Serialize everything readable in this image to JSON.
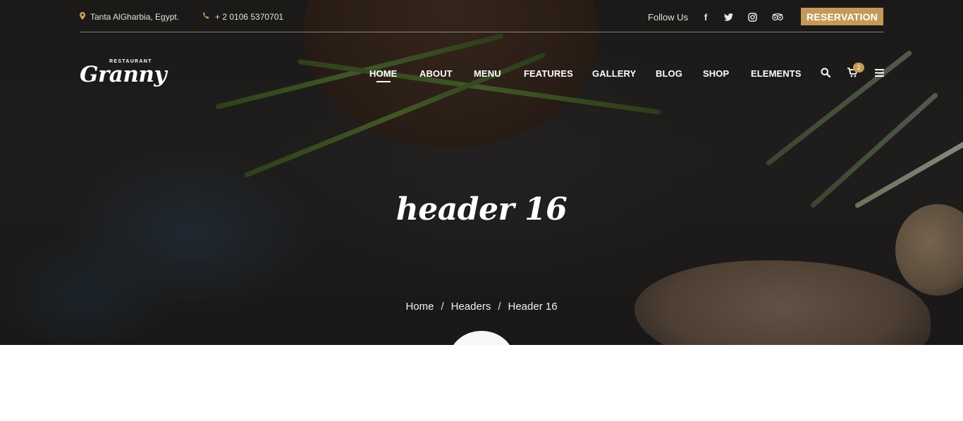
{
  "topbar": {
    "address": "Tanta AlGharbia, Egypt.",
    "phone": "+ 2 0106 5370701",
    "follow_label": "Follow Us",
    "social_icons": [
      "facebook-icon",
      "twitter-icon",
      "instagram-icon",
      "tripadvisor-icon"
    ],
    "reservation_label": "RESERVATION"
  },
  "logo": {
    "tag": "RESTAURANT",
    "name": "Granny"
  },
  "nav": {
    "items": [
      {
        "label": "HOME",
        "active": true
      },
      {
        "label": "ABOUT"
      },
      {
        "label": "MENU"
      },
      {
        "label": "FEATURES"
      },
      {
        "label": "GALLERY"
      },
      {
        "label": "BLOG"
      },
      {
        "label": "SHOP"
      },
      {
        "label": "ELEMENTS"
      }
    ],
    "cart_count": "2"
  },
  "hero": {
    "title": "header 16",
    "breadcrumbs": [
      "Home",
      "Headers",
      "Header 16"
    ],
    "separator": "/"
  },
  "colors": {
    "accent": "#c49a59",
    "dark": "#1f1e1d"
  }
}
